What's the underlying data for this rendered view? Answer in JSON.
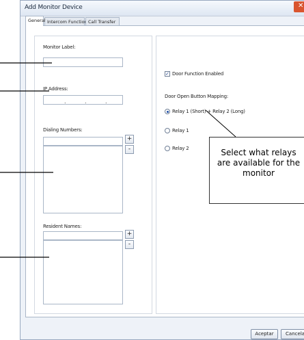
{
  "window": {
    "title": "Add Monitor Device",
    "close_glyph": "✕"
  },
  "tabs": [
    {
      "label": "General",
      "active": true
    },
    {
      "label": "Intercom Function",
      "active": false
    },
    {
      "label": "Call Transfer",
      "active": false
    }
  ],
  "left": {
    "monitor_label": "Monitor Label:",
    "ip_label": "IP Address:",
    "ip_dots": [
      ".",
      ".",
      "."
    ],
    "dialing_label": "Dialing Numbers:",
    "resident_label": "Resident Names:",
    "add_glyph": "+",
    "remove_glyph": "-"
  },
  "right": {
    "door_function_label": "Door Function Enabled",
    "door_function_checked": true,
    "check_glyph": "✓",
    "mapping_label": "Door Open Button Mapping:",
    "options": [
      {
        "label": "Relay 1 (Short) + Relay 2 (Long)",
        "selected": true
      },
      {
        "label": "Relay 1",
        "selected": false
      },
      {
        "label": "Relay 2",
        "selected": false
      }
    ]
  },
  "callout": {
    "lines": [
      "Select what relays",
      "are available for the",
      "monitor"
    ]
  },
  "footer": {
    "ok_label": "Aceptar",
    "cancel_label": "Cancelar"
  },
  "icons": {
    "close": "close-icon",
    "check": "check-icon"
  }
}
